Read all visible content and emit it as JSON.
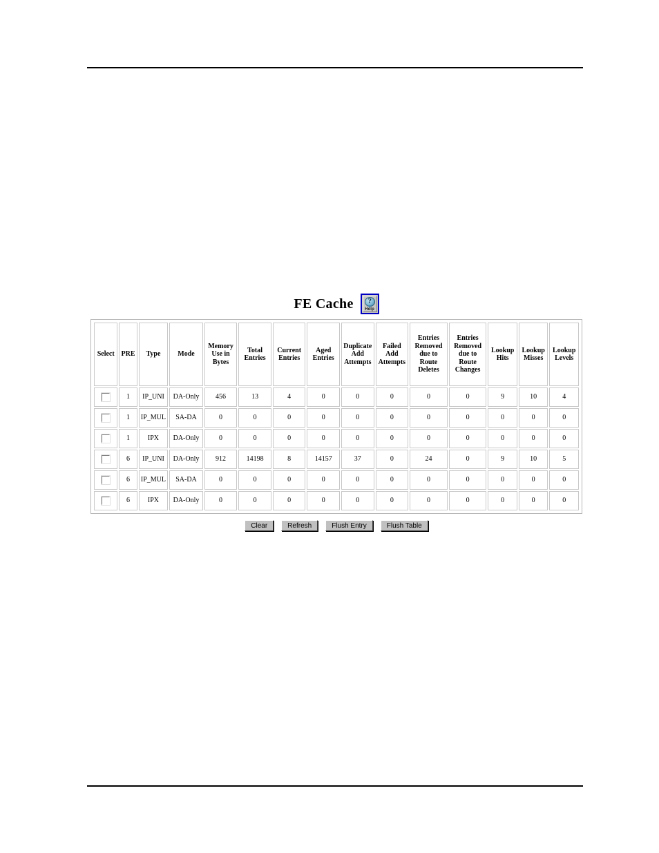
{
  "page": {
    "title": "FE Cache",
    "help_icon": "help-question-icon",
    "help_label": "Help"
  },
  "table": {
    "columns": [
      "Select",
      "PRE",
      "Type",
      "Mode",
      "Memory Use in Bytes",
      "Total Entries",
      "Current Entries",
      "Aged Entries",
      "Duplicate Add Attempts",
      "Failed Add Attempts",
      "Entries Removed due to Route Deletes",
      "Entries Removed due to Route Changes",
      "Lookup Hits",
      "Lookup Misses",
      "Lookup Levels"
    ],
    "rows": [
      {
        "select": "",
        "pre": "1",
        "type": "IP_UNI",
        "mode": "DA-Only",
        "memory_use_in_bytes": "456",
        "total_entries": "13",
        "current_entries": "4",
        "aged_entries": "0",
        "duplicate_add_attempts": "0",
        "failed_add_attempts": "0",
        "removed_route_deletes": "0",
        "removed_route_changes": "0",
        "lookup_hits": "9",
        "lookup_misses": "10",
        "lookup_levels": "4"
      },
      {
        "select": "",
        "pre": "1",
        "type": "IP_MUL",
        "mode": "SA-DA",
        "memory_use_in_bytes": "0",
        "total_entries": "0",
        "current_entries": "0",
        "aged_entries": "0",
        "duplicate_add_attempts": "0",
        "failed_add_attempts": "0",
        "removed_route_deletes": "0",
        "removed_route_changes": "0",
        "lookup_hits": "0",
        "lookup_misses": "0",
        "lookup_levels": "0"
      },
      {
        "select": "",
        "pre": "1",
        "type": "IPX",
        "mode": "DA-Only",
        "memory_use_in_bytes": "0",
        "total_entries": "0",
        "current_entries": "0",
        "aged_entries": "0",
        "duplicate_add_attempts": "0",
        "failed_add_attempts": "0",
        "removed_route_deletes": "0",
        "removed_route_changes": "0",
        "lookup_hits": "0",
        "lookup_misses": "0",
        "lookup_levels": "0"
      },
      {
        "select": "",
        "pre": "6",
        "type": "IP_UNI",
        "mode": "DA-Only",
        "memory_use_in_bytes": "912",
        "total_entries": "14198",
        "current_entries": "8",
        "aged_entries": "14157",
        "duplicate_add_attempts": "37",
        "failed_add_attempts": "0",
        "removed_route_deletes": "24",
        "removed_route_changes": "0",
        "lookup_hits": "9",
        "lookup_misses": "10",
        "lookup_levels": "5"
      },
      {
        "select": "",
        "pre": "6",
        "type": "IP_MUL",
        "mode": "SA-DA",
        "memory_use_in_bytes": "0",
        "total_entries": "0",
        "current_entries": "0",
        "aged_entries": "0",
        "duplicate_add_attempts": "0",
        "failed_add_attempts": "0",
        "removed_route_deletes": "0",
        "removed_route_changes": "0",
        "lookup_hits": "0",
        "lookup_misses": "0",
        "lookup_levels": "0"
      },
      {
        "select": "",
        "pre": "6",
        "type": "IPX",
        "mode": "DA-Only",
        "memory_use_in_bytes": "0",
        "total_entries": "0",
        "current_entries": "0",
        "aged_entries": "0",
        "duplicate_add_attempts": "0",
        "failed_add_attempts": "0",
        "removed_route_deletes": "0",
        "removed_route_changes": "0",
        "lookup_hits": "0",
        "lookup_misses": "0",
        "lookup_levels": "0"
      }
    ]
  },
  "buttons": [
    {
      "label": "Clear"
    },
    {
      "label": "Refresh"
    },
    {
      "label": "Flush Entry"
    },
    {
      "label": "Flush Table"
    }
  ]
}
